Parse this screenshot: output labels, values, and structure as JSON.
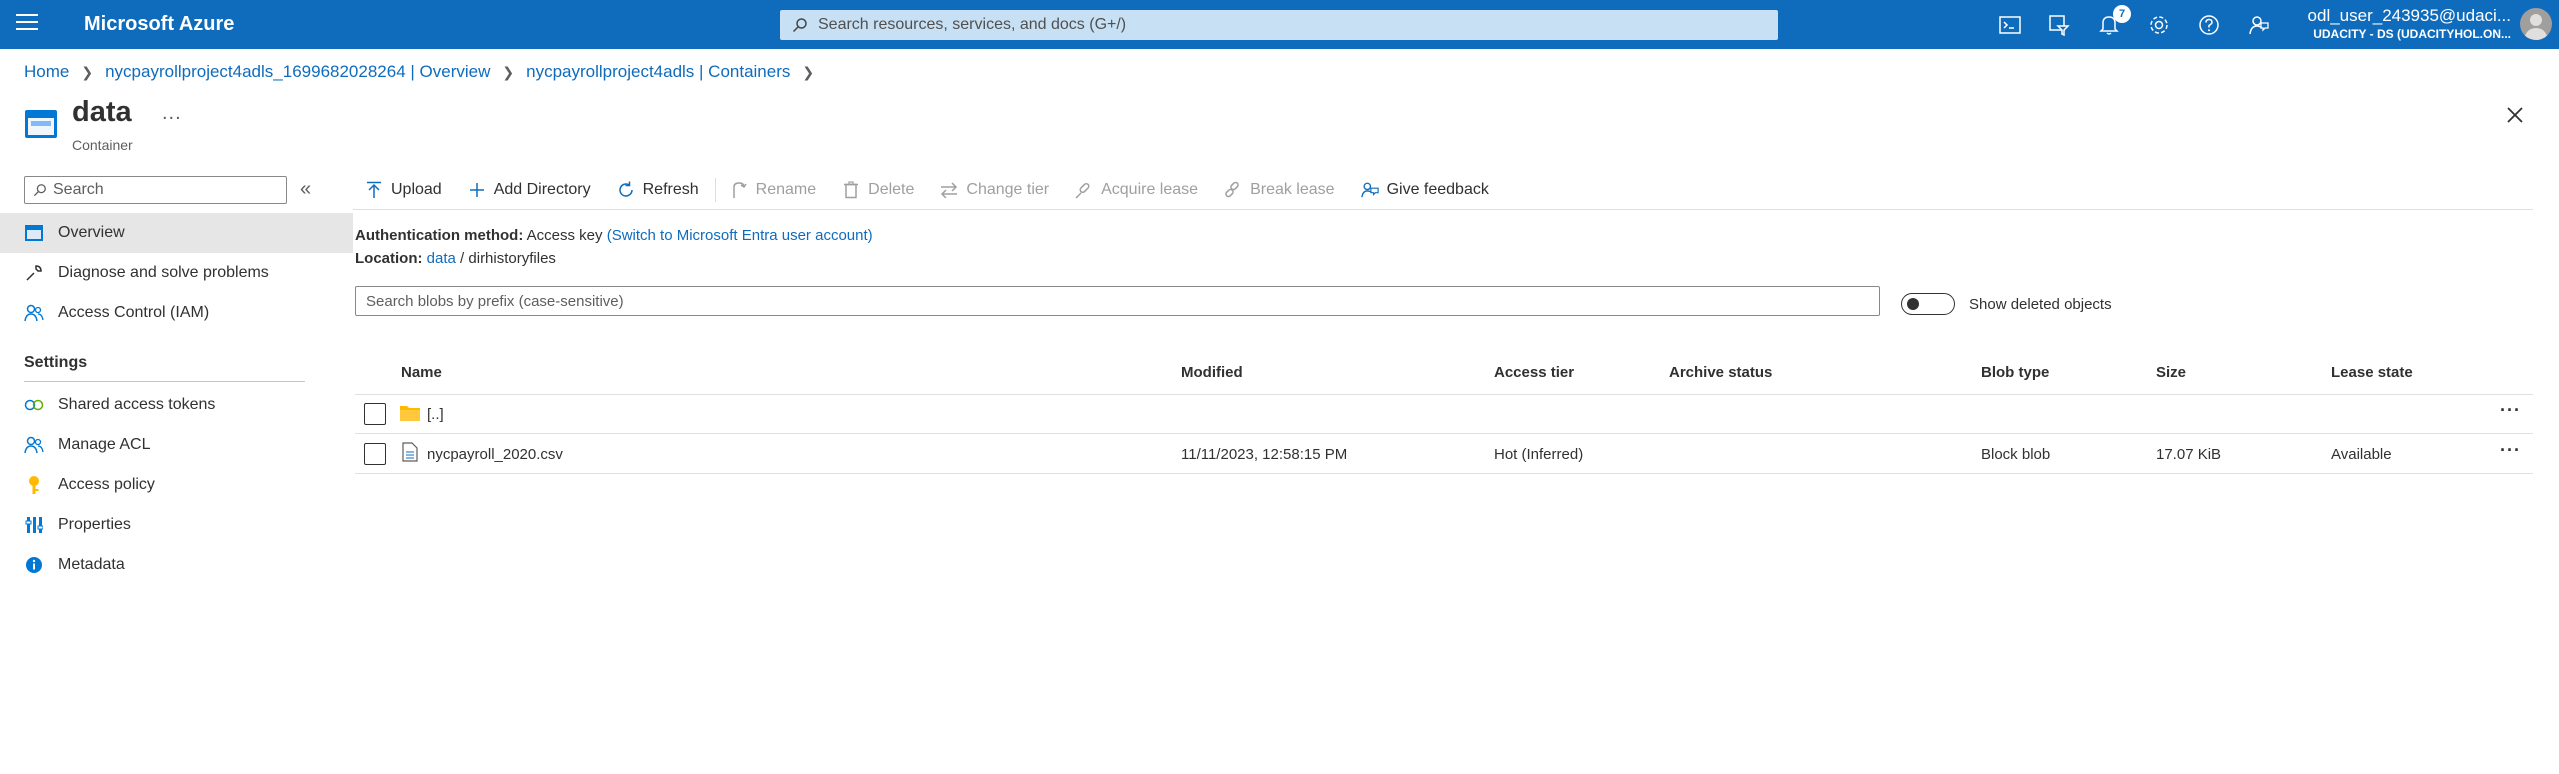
{
  "topbar": {
    "brand": "Microsoft Azure",
    "search_placeholder": "Search resources, services, and docs (G+/)",
    "notification_count": "7",
    "user_name": "odl_user_243935@udaci...",
    "user_tenant": "UDACITY - DS (UDACITYHOL.ON..."
  },
  "breadcrumb": {
    "home": "Home",
    "item1": "nycpayrollproject4adls_1699682028264 | Overview",
    "item2": "nycpayrollproject4adls | Containers"
  },
  "header": {
    "title": "data",
    "ellipsis": "...",
    "subtitle": "Container"
  },
  "sidebar": {
    "search_placeholder": "Search",
    "items": [
      {
        "label": "Overview"
      },
      {
        "label": "Diagnose and solve problems"
      },
      {
        "label": "Access Control (IAM)"
      }
    ],
    "settings_heading": "Settings",
    "settings_items": [
      {
        "label": "Shared access tokens"
      },
      {
        "label": "Manage ACL"
      },
      {
        "label": "Access policy"
      },
      {
        "label": "Properties"
      },
      {
        "label": "Metadata"
      }
    ]
  },
  "toolbar": {
    "upload": "Upload",
    "add_directory": "Add Directory",
    "refresh": "Refresh",
    "rename": "Rename",
    "delete": "Delete",
    "change_tier": "Change tier",
    "acquire_lease": "Acquire lease",
    "break_lease": "Break lease",
    "give_feedback": "Give feedback"
  },
  "info": {
    "auth_label": "Authentication method:",
    "auth_value": "Access key",
    "auth_link": "(Switch to Microsoft Entra user account)",
    "location_label": "Location:",
    "location_link": "data",
    "location_sep": "/",
    "location_folder": "dirhistoryfiles"
  },
  "blob_search_placeholder": "Search blobs by prefix (case-sensitive)",
  "show_deleted_label": "Show deleted objects",
  "table": {
    "columns": [
      "Name",
      "Modified",
      "Access tier",
      "Archive status",
      "Blob type",
      "Size",
      "Lease state"
    ],
    "rows": [
      {
        "name": "[..]",
        "modified": "",
        "access_tier": "",
        "archive_status": "",
        "blob_type": "",
        "size": "",
        "lease_state": ""
      },
      {
        "name": "nycpayroll_2020.csv",
        "modified": "11/11/2023, 12:58:15 PM",
        "access_tier": "Hot (Inferred)",
        "archive_status": "",
        "blob_type": "Block blob",
        "size": "17.07 KiB",
        "lease_state": "Available"
      }
    ],
    "more_label": "···"
  }
}
